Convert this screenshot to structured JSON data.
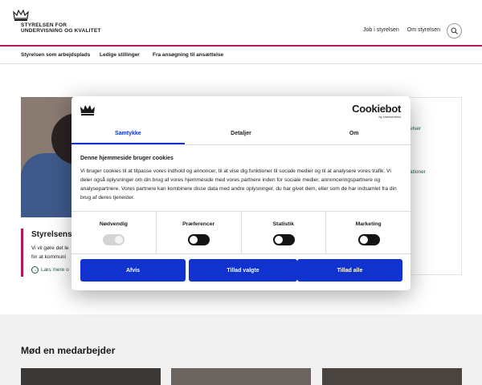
{
  "header": {
    "logo_line1": "STYRELSEN FOR",
    "logo_line2": "UNDERVISNING OG KVALITET",
    "links": [
      "Job i styrelsen",
      "Om styrelsen"
    ],
    "accent_color": "#b01a5a"
  },
  "subnav": {
    "items": [
      "Styrelsen som arbejdsplads",
      "Ledige stillinger",
      "Fra ansøgning til ansættelse"
    ]
  },
  "story": {
    "title": "Styrelsens f",
    "text_line1": "Vi vil gøre det le",
    "text_line2": "for at kommuni",
    "link": "Læs mere o"
  },
  "right_card": {
    "link1": "elser",
    "link2": "ationer"
  },
  "meet": {
    "title": "Mød en medarbejder"
  },
  "cookie_dialog": {
    "brand_name": "Cookiebot",
    "brand_sub": "by Usercentrics",
    "tabs": [
      "Samtykke",
      "Detaljer",
      "Om"
    ],
    "active_tab": "Samtykke",
    "heading": "Denne hjemmeside bruger cookies",
    "body": "Vi bruger cookies til at tilpasse vores indhold og annoncer, til at vise dig funktioner til sociale medier og til at analysere vores trafik. Vi deler også oplysninger om din brug af vores hjemmeside med vores partnere inden for sociale medier, annonceringspartnere og analysepartnere. Vores partnere kan kombinere disse data med andre oplysninger, du har givet dem, eller som de har indsamlet fra din brug af deres tjenester.",
    "categories": [
      {
        "label": "Nødvendig",
        "enabled": true,
        "locked": true
      },
      {
        "label": "Præferencer",
        "enabled": false,
        "locked": false
      },
      {
        "label": "Statistik",
        "enabled": false,
        "locked": false
      },
      {
        "label": "Marketing",
        "enabled": false,
        "locked": false
      }
    ],
    "buttons": {
      "deny": "Afvis",
      "allow_selected": "Tillad valgte",
      "allow_all": "Tillad alle"
    },
    "button_color": "#1032cf"
  }
}
